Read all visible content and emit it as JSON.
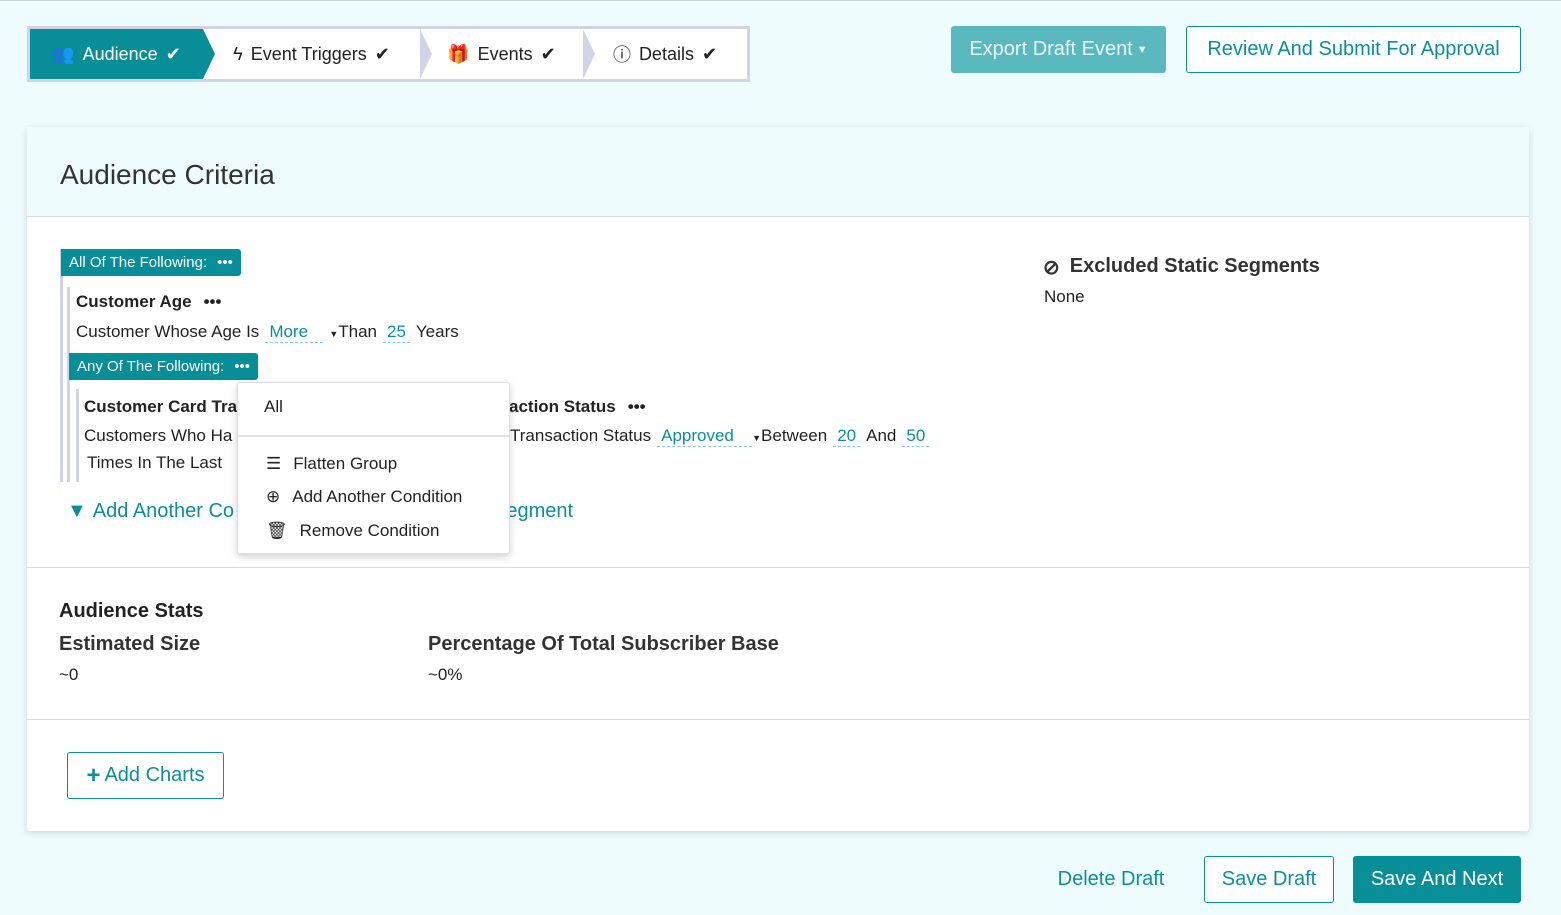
{
  "steps": [
    {
      "label": "Audience",
      "icon": "users-icon"
    },
    {
      "label": "Event Triggers",
      "icon": "bolt-icon"
    },
    {
      "label": "Events",
      "icon": "gift-icon"
    },
    {
      "label": "Details",
      "icon": "info-icon"
    }
  ],
  "header": {
    "export_label": "Export Draft Event",
    "review_label": "Review And Submit For Approval"
  },
  "card": {
    "title": "Audience Criteria",
    "root_group": "All Of The Following:",
    "cond1": {
      "title": "Customer Age",
      "prefix": "Customer Whose Age Is",
      "op": "More",
      "mid": "Than",
      "value": "25",
      "unit": "Years"
    },
    "sub_group": "Any Of The Following:",
    "cond2": {
      "title_left": "Customer Card Tra",
      "title_right": "action Status",
      "line1_left": "Customers Who Ha",
      "line1_right": "Transaction Status",
      "status": "Approved",
      "between": "Between",
      "v1": "20",
      "and": "And",
      "v2": "50",
      "line2": "Times In The Last"
    },
    "add_condition": "Add Another Co",
    "add_segment": "Segment",
    "excluded_title": "Excluded Static Segments",
    "excluded_value": "None"
  },
  "menu": {
    "header": "All",
    "items": [
      "Flatten Group",
      "Add Another Condition",
      "Remove Condition"
    ]
  },
  "stats": {
    "title": "Audience Stats",
    "size_label": "Estimated Size",
    "size_value": "~0",
    "pct_label": "Percentage Of Total Subscriber Base",
    "pct_value": "~0%"
  },
  "charts": {
    "add_label": "Add Charts"
  },
  "footer": {
    "delete": "Delete Draft",
    "save": "Save Draft",
    "next": "Save And Next"
  }
}
